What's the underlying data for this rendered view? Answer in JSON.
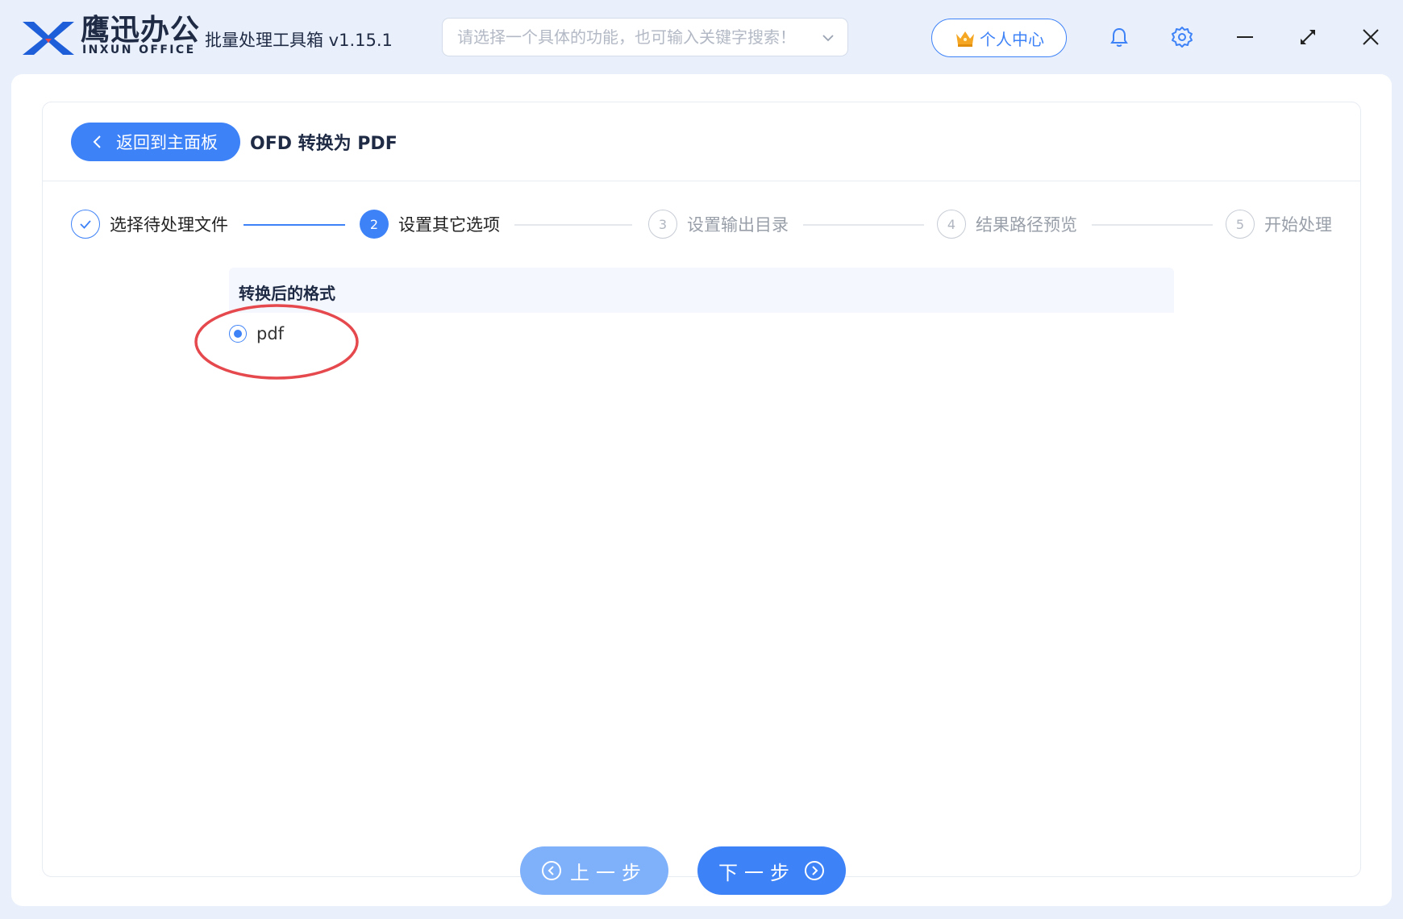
{
  "header": {
    "brand_name": "鹰迅办公",
    "brand_sub": "INXUN OFFICE",
    "app_title": "批量处理工具箱 v1.15.1",
    "search_placeholder": "请选择一个具体的功能，也可输入关键字搜索！",
    "user_center_label": "个人中心"
  },
  "page": {
    "back_label": "返回到主面板",
    "title": "OFD 转换为 PDF"
  },
  "steps": [
    {
      "number": "1",
      "label": "选择待处理文件",
      "state": "done"
    },
    {
      "number": "2",
      "label": "设置其它选项",
      "state": "active"
    },
    {
      "number": "3",
      "label": "设置输出目录",
      "state": "todo"
    },
    {
      "number": "4",
      "label": "结果路径预览",
      "state": "todo"
    },
    {
      "number": "5",
      "label": "开始处理",
      "state": "todo"
    }
  ],
  "options": {
    "section_title": "转换后的格式",
    "format_choice": "pdf",
    "format_selected": true
  },
  "nav": {
    "prev_label": "上一步",
    "next_label": "下一步"
  },
  "colors": {
    "accent": "#3e82f7",
    "accent_light": "#7fb0fa",
    "highlight": "#e5484d"
  }
}
